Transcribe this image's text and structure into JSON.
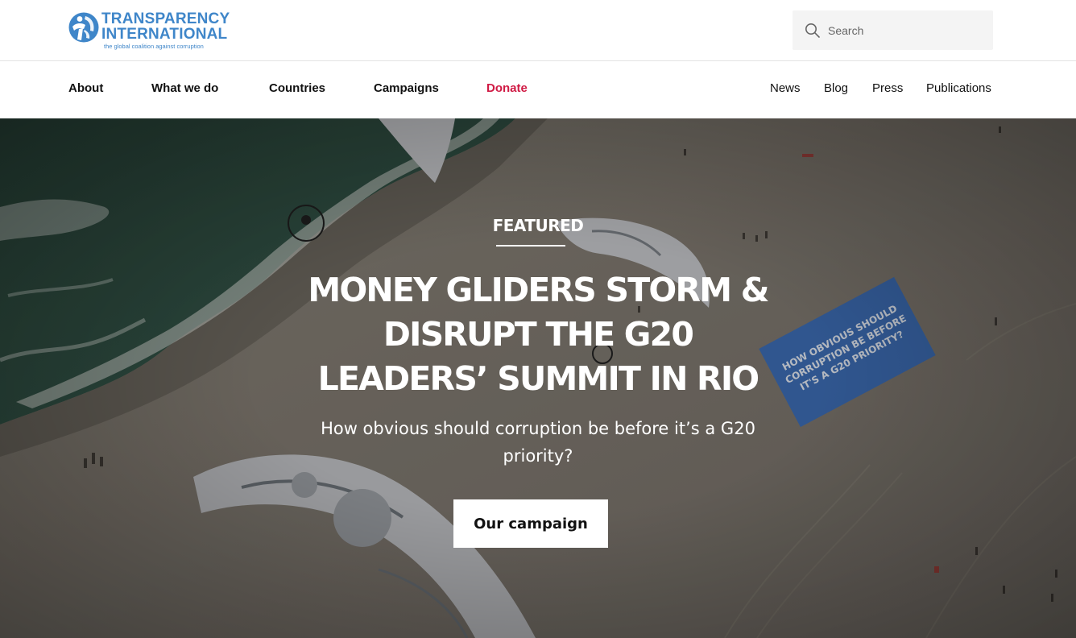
{
  "brand": {
    "line1": "TRANSPARENCY",
    "line2": "INTERNATIONAL",
    "tagline": "the global coalition against corruption",
    "color": "#3f86c9"
  },
  "search": {
    "placeholder": "Search"
  },
  "nav": {
    "main": [
      {
        "label": "About"
      },
      {
        "label": "What we do"
      },
      {
        "label": "Countries"
      },
      {
        "label": "Campaigns"
      },
      {
        "label": "Donate"
      }
    ],
    "secondary": [
      {
        "label": "News"
      },
      {
        "label": "Blog"
      },
      {
        "label": "Press"
      },
      {
        "label": "Publications"
      }
    ],
    "accent_color": "#d01a44"
  },
  "hero": {
    "eyebrow": "FEATURED",
    "headline": "MONEY GLIDERS STORM & DISRUPT THE G20 LEADERS’ SUMMIT IN RIO",
    "subhead": "How obvious should corruption be before it’s a G20 priority?",
    "cta": "Our campaign",
    "banner_text": "HOW OBVIOUS SHOULD CORRUPTION BE BEFORE IT’S A G20 PRIORITY?"
  }
}
